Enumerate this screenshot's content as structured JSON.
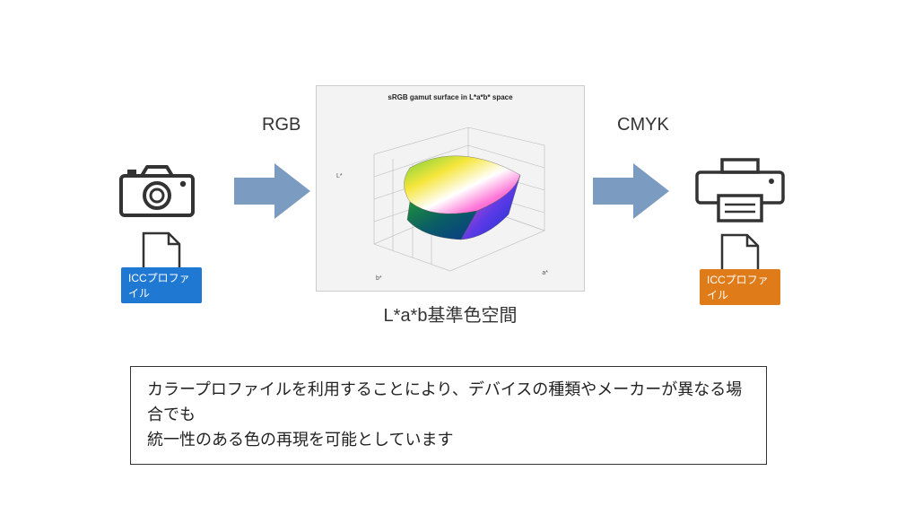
{
  "labels": {
    "rgb": "RGB",
    "cmyk": "CMYK",
    "icc_blue": "ICCプロファイル",
    "icc_orange": "ICCプロファイル",
    "center_caption": "L*a*b基準色空間",
    "desc_line1": "カラープロファイルを利用することにより、デバイスの種類やメーカーが異なる場合でも",
    "desc_line2": "統一性のある色の再現を可能としています"
  },
  "chart_data": {
    "type": "surface",
    "title": "sRGB gamut surface in L*a*b* space",
    "axes": {
      "x": {
        "label": "a*",
        "range": [
          -80,
          80
        ],
        "ticks": [
          -80,
          -60,
          -40,
          -20,
          0,
          20,
          40,
          60,
          80
        ]
      },
      "y": {
        "label": "b*",
        "range": [
          -100,
          100
        ],
        "ticks": [
          -100,
          -50,
          0,
          50,
          100
        ]
      },
      "z": {
        "label": "L*",
        "range": [
          0,
          100
        ],
        "ticks": [
          0,
          50,
          100
        ]
      }
    },
    "description": "3D perspective plot of the sRGB color gamut volume mapped into CIELAB space; surface colored by corresponding RGB hue (greens/yellows at high L*, magentas/reds at +a*, blues at -b* low L*).",
    "grid": true,
    "background": "#f3f3f3"
  },
  "colors": {
    "arrow": "#7b9bc1",
    "icc_blue_bg": "#1f78d1",
    "icc_orange_bg": "#e07b1a",
    "stroke": "#333333"
  }
}
